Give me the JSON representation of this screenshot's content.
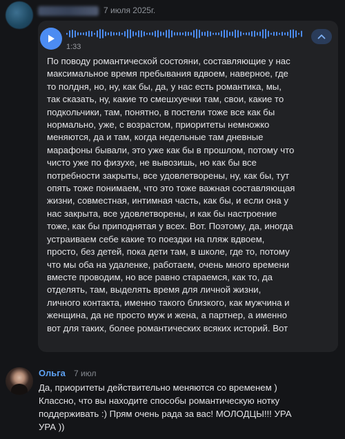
{
  "post": {
    "date": "7 июля 2025г.",
    "audio": {
      "duration": "1:33"
    },
    "transcript_lines": [
      "По поводу романтической состояни, составляющие у нас",
      "максимальное время пребывания вдвоем, наверное, где",
      "то полдня, но, ну, как бы, да, у нас есть романтика, мы,",
      "так сказать, ну, какие то смешхуечки там, свои, какие то",
      "подкольчики, там, понятно, в постели тоже все как бы",
      "нормально, уже, с возрастом, приоритеты немножко",
      "меняются, да и там, когда недельные там дневные",
      "марафоны бывали, это уже как бы в прошлом, потому что",
      "чисто уже по физухе, не вывозишь, но как бы все",
      "потребности закрыты, все удовлетворены, ну, как бы, тут",
      "опять тоже понимаем, что это тоже важная составляющая",
      "жизни, совместная, интимная часть, как бы, и если она у",
      "нас закрыта, все удовлетворены, и как бы настроение",
      "тоже, как бы приподнятая у всех. Вот. Поэтому, да, иногда",
      "устраиваем себе какие то поездки на пляж вдвоем,",
      "просто, без детей, пока дети там, в школе, где то, потому",
      "что мы оба на удаленке, работаем, очень много времени",
      "вместе проводим, но все равно стараемся, как то, да",
      "отделять, там, выделять время для личной жизни,",
      "личного контакта, именно такого близкого, как мужчина и",
      "женщина, да не просто муж и жена, а партнер, а именно",
      "вот для таких, более романтических всяких историй. Вот"
    ]
  },
  "reply": {
    "author": "Ольга",
    "date": "7 июл",
    "lines": [
      "Да, приоритеты действительно меняются со временем )",
      "Классно, что вы находите способы романтическую нотку",
      "поддерживать :) Прям очень рада за вас! МОЛОДЦЫ!!! УРА",
      "УРА ))"
    ]
  },
  "icons": {
    "play": "play-icon",
    "collapse": "chevron-up-icon",
    "accent_color": "#4c8cf2",
    "author_color": "#5ea2f3"
  }
}
